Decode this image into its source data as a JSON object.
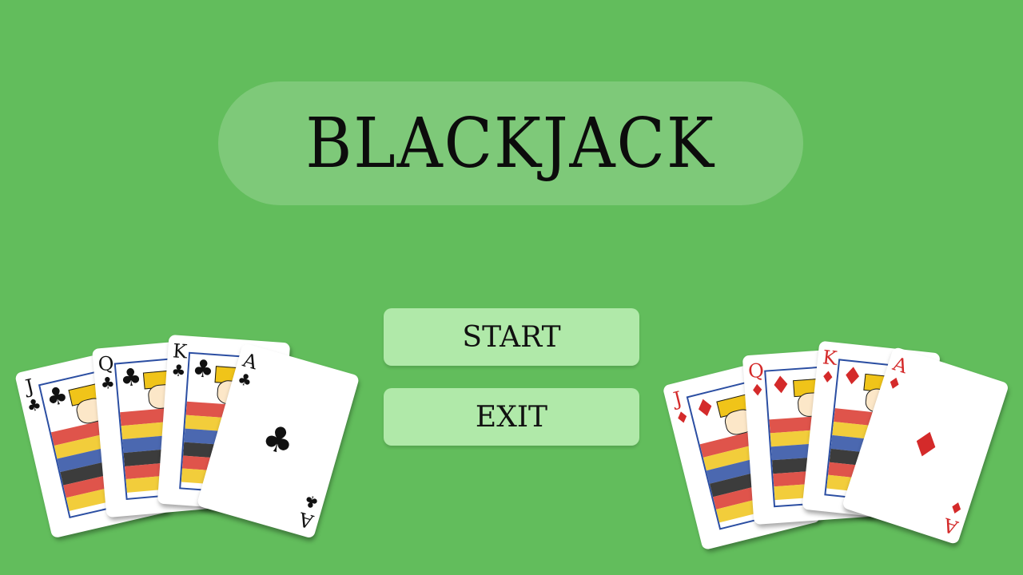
{
  "title": "BLACKJACK",
  "menu": {
    "start_label": "START",
    "exit_label": "EXIT"
  },
  "hands": {
    "left": {
      "suit_name": "clubs",
      "suit_glyph": "♣",
      "color": "#111111",
      "cards": [
        {
          "rank": "J",
          "kind": "face"
        },
        {
          "rank": "Q",
          "kind": "face"
        },
        {
          "rank": "K",
          "kind": "face"
        },
        {
          "rank": "A",
          "kind": "ace"
        }
      ]
    },
    "right": {
      "suit_name": "diamonds",
      "suit_glyph": "♦",
      "color": "#d42a2a",
      "cards": [
        {
          "rank": "J",
          "kind": "face"
        },
        {
          "rank": "Q",
          "kind": "face"
        },
        {
          "rank": "K",
          "kind": "face"
        },
        {
          "rank": "A",
          "kind": "ace"
        }
      ]
    }
  },
  "colors": {
    "table_green": "#62bd5c",
    "button_green": "#b0e9a9"
  }
}
